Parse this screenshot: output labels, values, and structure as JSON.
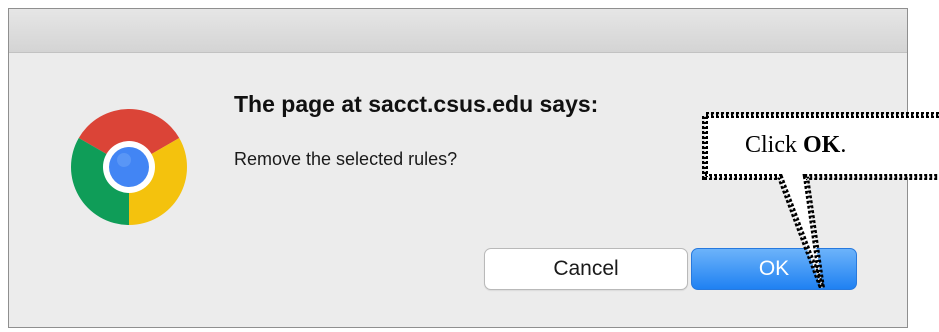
{
  "dialog": {
    "heading": "The page at sacct.csus.edu says:",
    "message": "Remove the selected rules?",
    "cancel_label": "Cancel",
    "ok_label": "OK",
    "logo_icon": "chrome-logo-icon"
  },
  "callout": {
    "prefix": "Click ",
    "emphasis": "OK",
    "suffix": "."
  },
  "colors": {
    "ok_button": "#1f81f2",
    "dialog_background": "#ececec",
    "chrome_red": "#db4437",
    "chrome_yellow": "#f4c20d",
    "chrome_green": "#0f9d58",
    "chrome_blue": "#4285f4"
  }
}
